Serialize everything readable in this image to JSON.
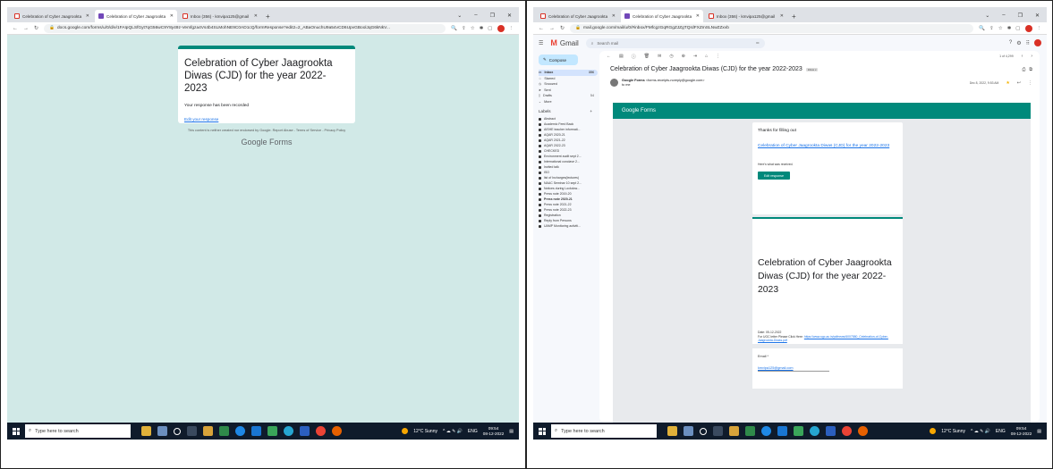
{
  "left": {
    "tabs": [
      {
        "label": "Celebration of Cyber Jaagrookta",
        "icon": "gmail-icon",
        "active": false
      },
      {
        "label": "Celebration of Cyber Jaagrookta",
        "icon": "forms-icon",
        "active": true
      },
      {
        "label": "Inbox (356) - kmvipa125@gmail",
        "icon": "gmail-icon",
        "active": false
      }
    ],
    "url": "docs.google.com/forms/u/0/d/e/1FAIpQLSfGyt7qG56wC9Y8y49z-Vemfgza4Vs4b4SLMohNE9C0AD1cQ/formResponse?edit2=2_ABaOnuchU9a54vCD6UpvGBoolJqG6kNkV...",
    "form": {
      "title": "Celebration of Cyber Jaagrookta Diwas (CJD) for the year 2022-2023",
      "recorded": "Your response has been recorded",
      "edit_link": "Edit your response",
      "disclaimer": "This content is neither created nor endorsed by Google. Report Abuse - Terms of Service - Privacy Policy",
      "logo": "Google Forms"
    }
  },
  "right": {
    "tabs": [
      {
        "label": "Celebration of Cyber Jaagrookta",
        "icon": "gmail-icon",
        "active": false
      },
      {
        "label": "Celebration of Cyber Jaagrookta",
        "icon": "forms-icon",
        "active": true
      },
      {
        "label": "Inbox (356) - kmvipa125@gmail",
        "icon": "gmail-icon",
        "active": false
      }
    ],
    "url": "mail.google.com/mail/u/0/#inbox/FMfcgzGqRGgZJZgTQrdFXZmSLNwZZxvb",
    "gmail": {
      "logo": "Gmail",
      "search_placeholder": "Search mail",
      "compose": "Compose",
      "nav": [
        {
          "label": "Inbox",
          "count": "356",
          "active": true
        },
        {
          "label": "Starred",
          "count": ""
        },
        {
          "label": "Snoozed",
          "count": ""
        },
        {
          "label": "Sent",
          "count": ""
        },
        {
          "label": "Drafts",
          "count": "54"
        },
        {
          "label": "More",
          "count": ""
        }
      ],
      "labels_title": "Labels",
      "labels": [
        {
          "label": "Abstract",
          "bold": false
        },
        {
          "label": "Academic Feed Back",
          "bold": false
        },
        {
          "label": "AISHE teacher informati...",
          "bold": false
        },
        {
          "label": "AQAR 2020-21",
          "bold": false
        },
        {
          "label": "AQAR 2021-22",
          "bold": false
        },
        {
          "label": "AQAR 2022-23",
          "bold": false
        },
        {
          "label": "CHECKED",
          "bold": false
        },
        {
          "label": "Environment audit sept 2...",
          "bold": false
        },
        {
          "label": "International conclave 2...",
          "bold": false
        },
        {
          "label": "Invited talk",
          "bold": false
        },
        {
          "label": "ISO",
          "bold": false
        },
        {
          "label": "list of Incharges(lectures)",
          "bold": false
        },
        {
          "label": "NAAC Seminar 10 sept 2...",
          "bold": false
        },
        {
          "label": "Notices during Lockdow...",
          "bold": false
        },
        {
          "label": "Press note 2019-20",
          "bold": false
        },
        {
          "label": "Press note 2020-21",
          "bold": true
        },
        {
          "label": "Press note 2021-22",
          "bold": false
        },
        {
          "label": "Press note 2022-23",
          "bold": false
        },
        {
          "label": "Registration",
          "bold": false
        },
        {
          "label": "Reply from Persons",
          "bold": false
        },
        {
          "label": "UAMP Monitoring activiti...",
          "bold": false
        }
      ],
      "pager": "1 of 4,299",
      "subject": "Celebration of Cyber Jaagrookta Diwas (CJD) for the year 2022-2023",
      "subject_badge": "Inbox x",
      "sender_name": "Google Forms",
      "sender_email": "<forms-receipts-noreply@google.com>",
      "sender_to": "to me",
      "date": "Dec 8, 2022, 9:53 AM",
      "email_header": "Google Forms",
      "thanks": "Thanks for filling out",
      "form_link": "Celebration of Cyber Jaagrookta Diwas (CJD) for the year 2022-2023",
      "received": "Here's what was received.",
      "edit_button": "Edit response",
      "form_title": "Celebration of Cyber Jaagrookta Diwas (CJD) for the year 2022-2023",
      "form_date": "Date: 05-12-2022",
      "ugc_prefix": "For UGC letter Please Click Here:",
      "ugc_link": "https://www.ugc.ac.in/pdfnews/6007580_Celebration-of-Cyber-Jaagrookta-Diwas.pdf",
      "email_label": "Email *",
      "email_value": "kmvipa125@gmail.com"
    }
  },
  "taskbar": {
    "search_placeholder": "Type here to search",
    "weather": "12°C Sunny",
    "lang": "ENG",
    "time": "09:54",
    "date": "08-12-2022"
  },
  "colors": {
    "teal": "#00897b",
    "forms_bg": "#d1e9e7",
    "taskbar": "#0f1b2b"
  }
}
